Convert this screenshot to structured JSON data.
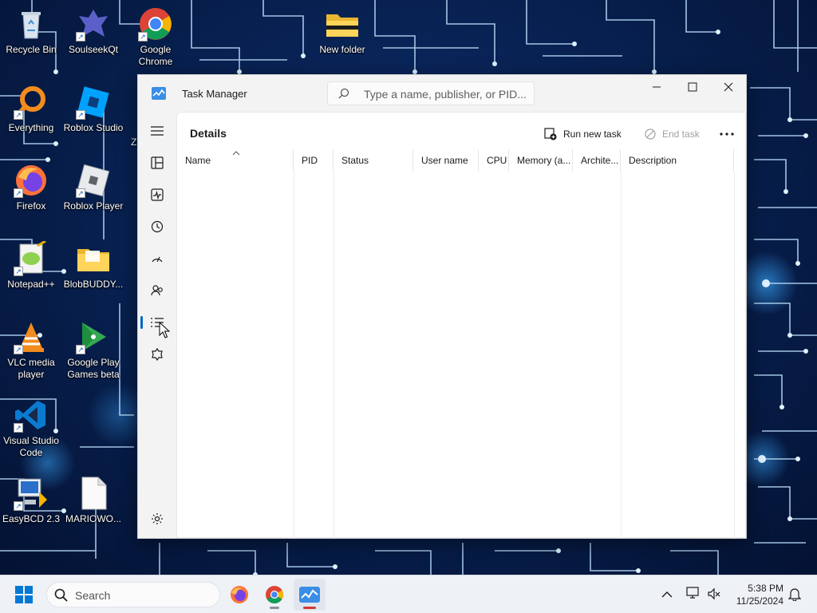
{
  "desktop": {
    "icons": [
      {
        "label": "Recycle Bin",
        "icon": "recycle-bin-icon"
      },
      {
        "label": "SoulseekQt",
        "icon": "soulseek-icon"
      },
      {
        "label": "Google Chrome",
        "icon": "chrome-icon"
      },
      {
        "label": "New folder",
        "icon": "folder-icon"
      },
      {
        "label": "Everything",
        "icon": "everything-icon"
      },
      {
        "label": "Roblox Studio",
        "icon": "roblox-studio-icon"
      },
      {
        "label": "Firefox",
        "icon": "firefox-icon"
      },
      {
        "label": "Roblox Player",
        "icon": "roblox-player-icon"
      },
      {
        "label": "Notepad++",
        "icon": "notepad-plus-plus-icon"
      },
      {
        "label": "BlobBUDDY...",
        "icon": "folder-icon"
      },
      {
        "label": "VLC media player",
        "icon": "vlc-icon"
      },
      {
        "label": "Google Play Games beta",
        "icon": "google-play-games-icon"
      },
      {
        "label": "Visual Studio Code",
        "icon": "vscode-icon"
      },
      {
        "label": "EasyBCD 2.3",
        "icon": "easybcd-icon"
      },
      {
        "label": "MARIOWO...",
        "icon": "document-icon"
      }
    ],
    "partial_label": "Z"
  },
  "task_manager": {
    "title": "Task Manager",
    "search_placeholder": "Type a name, publisher, or PID...",
    "page_title": "Details",
    "commands": {
      "run_new_task": "Run new task",
      "end_task": "End task"
    },
    "nav": [
      "hamburger-menu",
      "processes",
      "performance",
      "app-history",
      "startup-apps",
      "users",
      "details",
      "services",
      "settings"
    ],
    "active_nav": "details",
    "columns": [
      "Name",
      "PID",
      "Status",
      "User name",
      "CPU",
      "Memory (a...",
      "Archite...",
      "Description"
    ],
    "sort_column": "Name",
    "rows": []
  },
  "taskbar": {
    "search_label": "Search",
    "apps": [
      "firefox",
      "chrome",
      "task-manager"
    ],
    "active_app": "task-manager",
    "time": "5:38 PM",
    "date": "11/25/2024"
  },
  "colors": {
    "accent": "#0067c0",
    "wallpaper": "#071f4d",
    "circuit": "#bfe2ff"
  }
}
